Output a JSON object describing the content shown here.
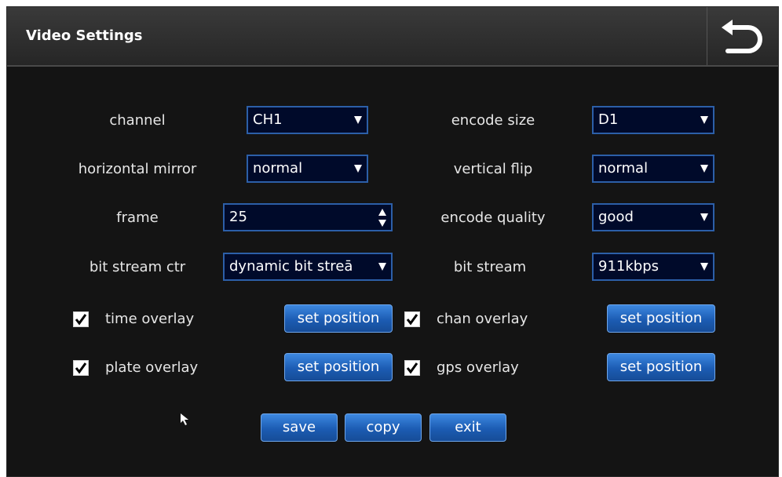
{
  "window": {
    "title": "Video Settings"
  },
  "fields": {
    "channel": {
      "label": "channel",
      "value": "CH1"
    },
    "encode_size": {
      "label": "encode size",
      "value": "D1"
    },
    "horizontal_mirror": {
      "label": "horizontal mirror",
      "value": "normal"
    },
    "vertical_flip": {
      "label": "vertical flip",
      "value": "normal"
    },
    "frame": {
      "label": "frame",
      "value": "25"
    },
    "encode_quality": {
      "label": "encode quality",
      "value": "good"
    },
    "bit_stream_ctr": {
      "label": "bit stream ctr",
      "value": "dynamic bit streā"
    },
    "bit_stream": {
      "label": "bit stream",
      "value": "911kbps"
    }
  },
  "overlays": {
    "time": {
      "label": "time overlay",
      "checked": true,
      "button": "set position"
    },
    "chan": {
      "label": "chan overlay",
      "checked": true,
      "button": "set position"
    },
    "plate": {
      "label": "plate overlay",
      "checked": true,
      "button": "set position"
    },
    "gps": {
      "label": "gps overlay",
      "checked": true,
      "button": "set position"
    }
  },
  "actions": {
    "save": "save",
    "copy": "copy",
    "exit": "exit"
  },
  "icons": {
    "back": "back-arrow-icon",
    "checkmark": "checkmark-icon",
    "dropdown": "dropdown-arrow-icon",
    "spinner": "spinner-arrows-icon",
    "cursor": "mouse-pointer-icon"
  },
  "colors": {
    "background": "#141414",
    "field_border": "#2c5fa8",
    "field_bg": "#000a2a",
    "button": "#1c5cb3"
  }
}
